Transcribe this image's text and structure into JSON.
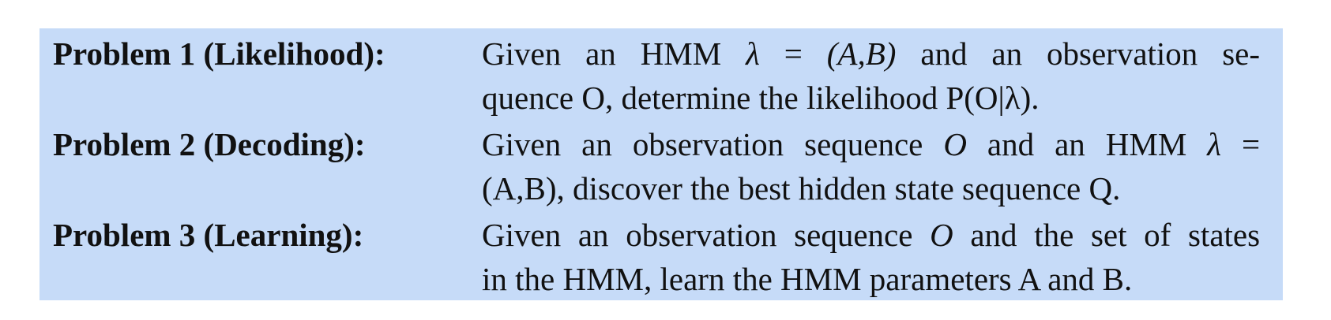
{
  "problems": [
    {
      "label": "Problem 1 (Likelihood):",
      "line1": [
        "Given",
        "an",
        "HMM",
        "λ",
        "=",
        "(A,B)",
        "and",
        "an",
        "observation",
        "se-"
      ],
      "line2": "quence O, determine the likelihood P(O|λ)."
    },
    {
      "label": "Problem 2 (Decoding):",
      "line1": [
        "Given",
        "an",
        "observation",
        "sequence",
        "O",
        "and",
        "an",
        "HMM",
        "λ",
        "="
      ],
      "line2": "(A,B), discover the best hidden state sequence Q."
    },
    {
      "label": "Problem 3 (Learning):",
      "line1": [
        "Given",
        "an",
        "observation",
        "sequence",
        "O",
        "and",
        "the",
        "set",
        "of",
        "states"
      ],
      "line2": "in the HMM, learn the HMM parameters A and B."
    }
  ]
}
